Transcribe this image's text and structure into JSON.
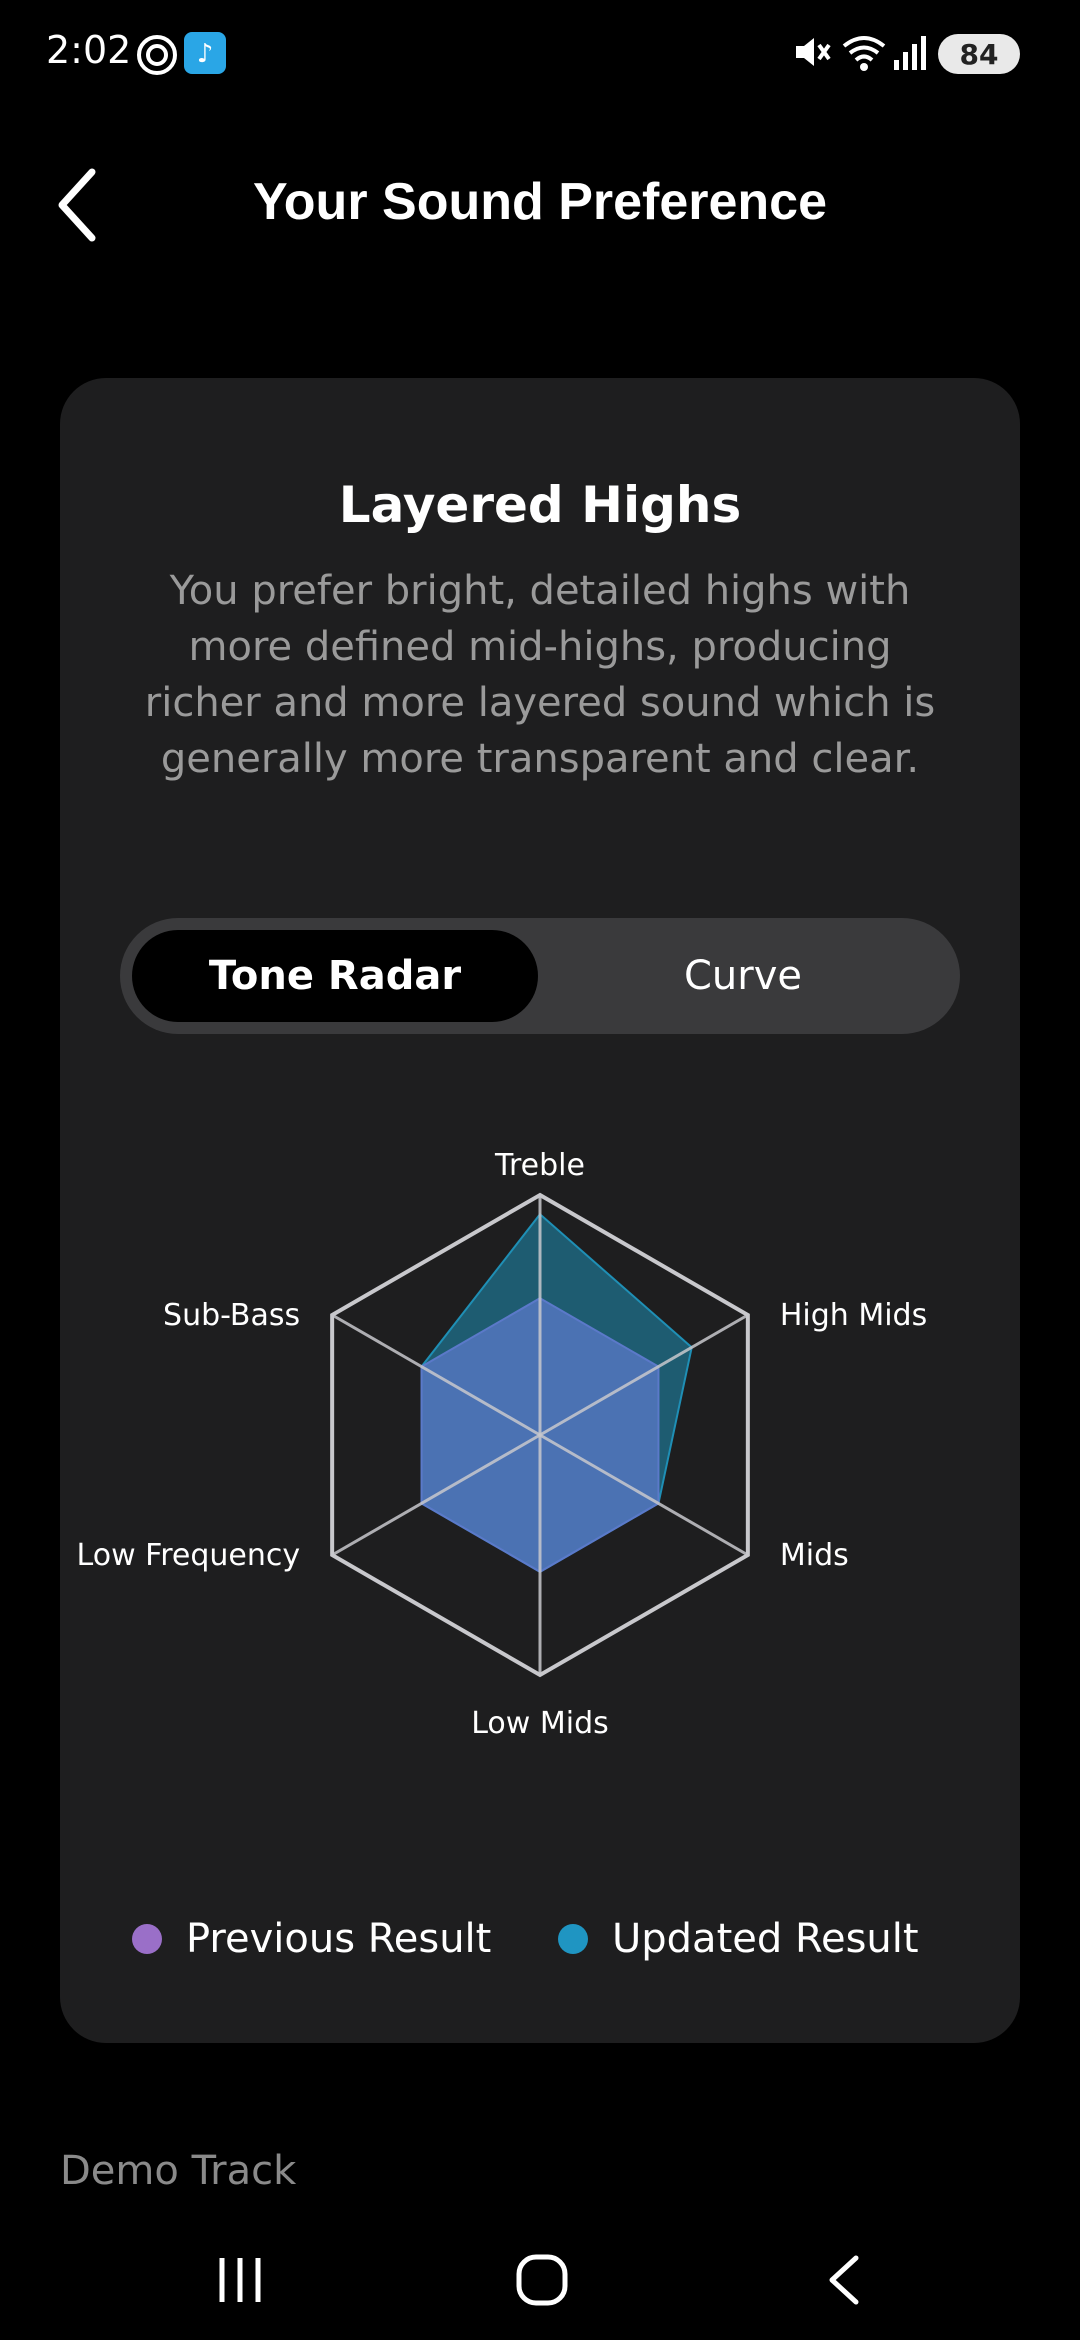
{
  "status_bar": {
    "time": "2:02",
    "battery": "84",
    "icons": [
      "threads-icon",
      "music-app-icon",
      "mute-icon",
      "wifi-icon",
      "signal-icon",
      "battery-icon"
    ]
  },
  "header": {
    "title": "Your Sound Preference",
    "back_icon": "chevron-left-icon"
  },
  "card": {
    "title": "Layered Highs",
    "description": "You prefer bright, detailed highs with more defined mid-highs, producing richer and more layered sound which is generally more transparent and clear.",
    "tabs": [
      {
        "label": "Tone Radar",
        "active": true
      },
      {
        "label": "Curve",
        "active": false
      }
    ]
  },
  "chart_data": {
    "type": "radar",
    "axes": [
      "Treble",
      "High Mids",
      "Mids",
      "Low Mids",
      "Low Frequency",
      "Sub-Bass"
    ],
    "range": [
      0,
      1
    ],
    "series": [
      {
        "name": "Previous Result",
        "color": "#5b79c9",
        "values": [
          0.57,
          0.57,
          0.57,
          0.57,
          0.57,
          0.57
        ]
      },
      {
        "name": "Updated Result",
        "color": "#1f8fb5",
        "values": [
          0.92,
          0.73,
          0.57,
          0.57,
          0.57,
          0.57
        ]
      }
    ]
  },
  "legend": {
    "previous": {
      "label": "Previous Result",
      "color": "#9a6fc8"
    },
    "updated": {
      "label": "Updated Result",
      "color": "#1f95c2"
    }
  },
  "demo_track": "Demo Track",
  "nav": {
    "icons": [
      "recent-apps-icon",
      "home-icon",
      "back-icon"
    ]
  }
}
